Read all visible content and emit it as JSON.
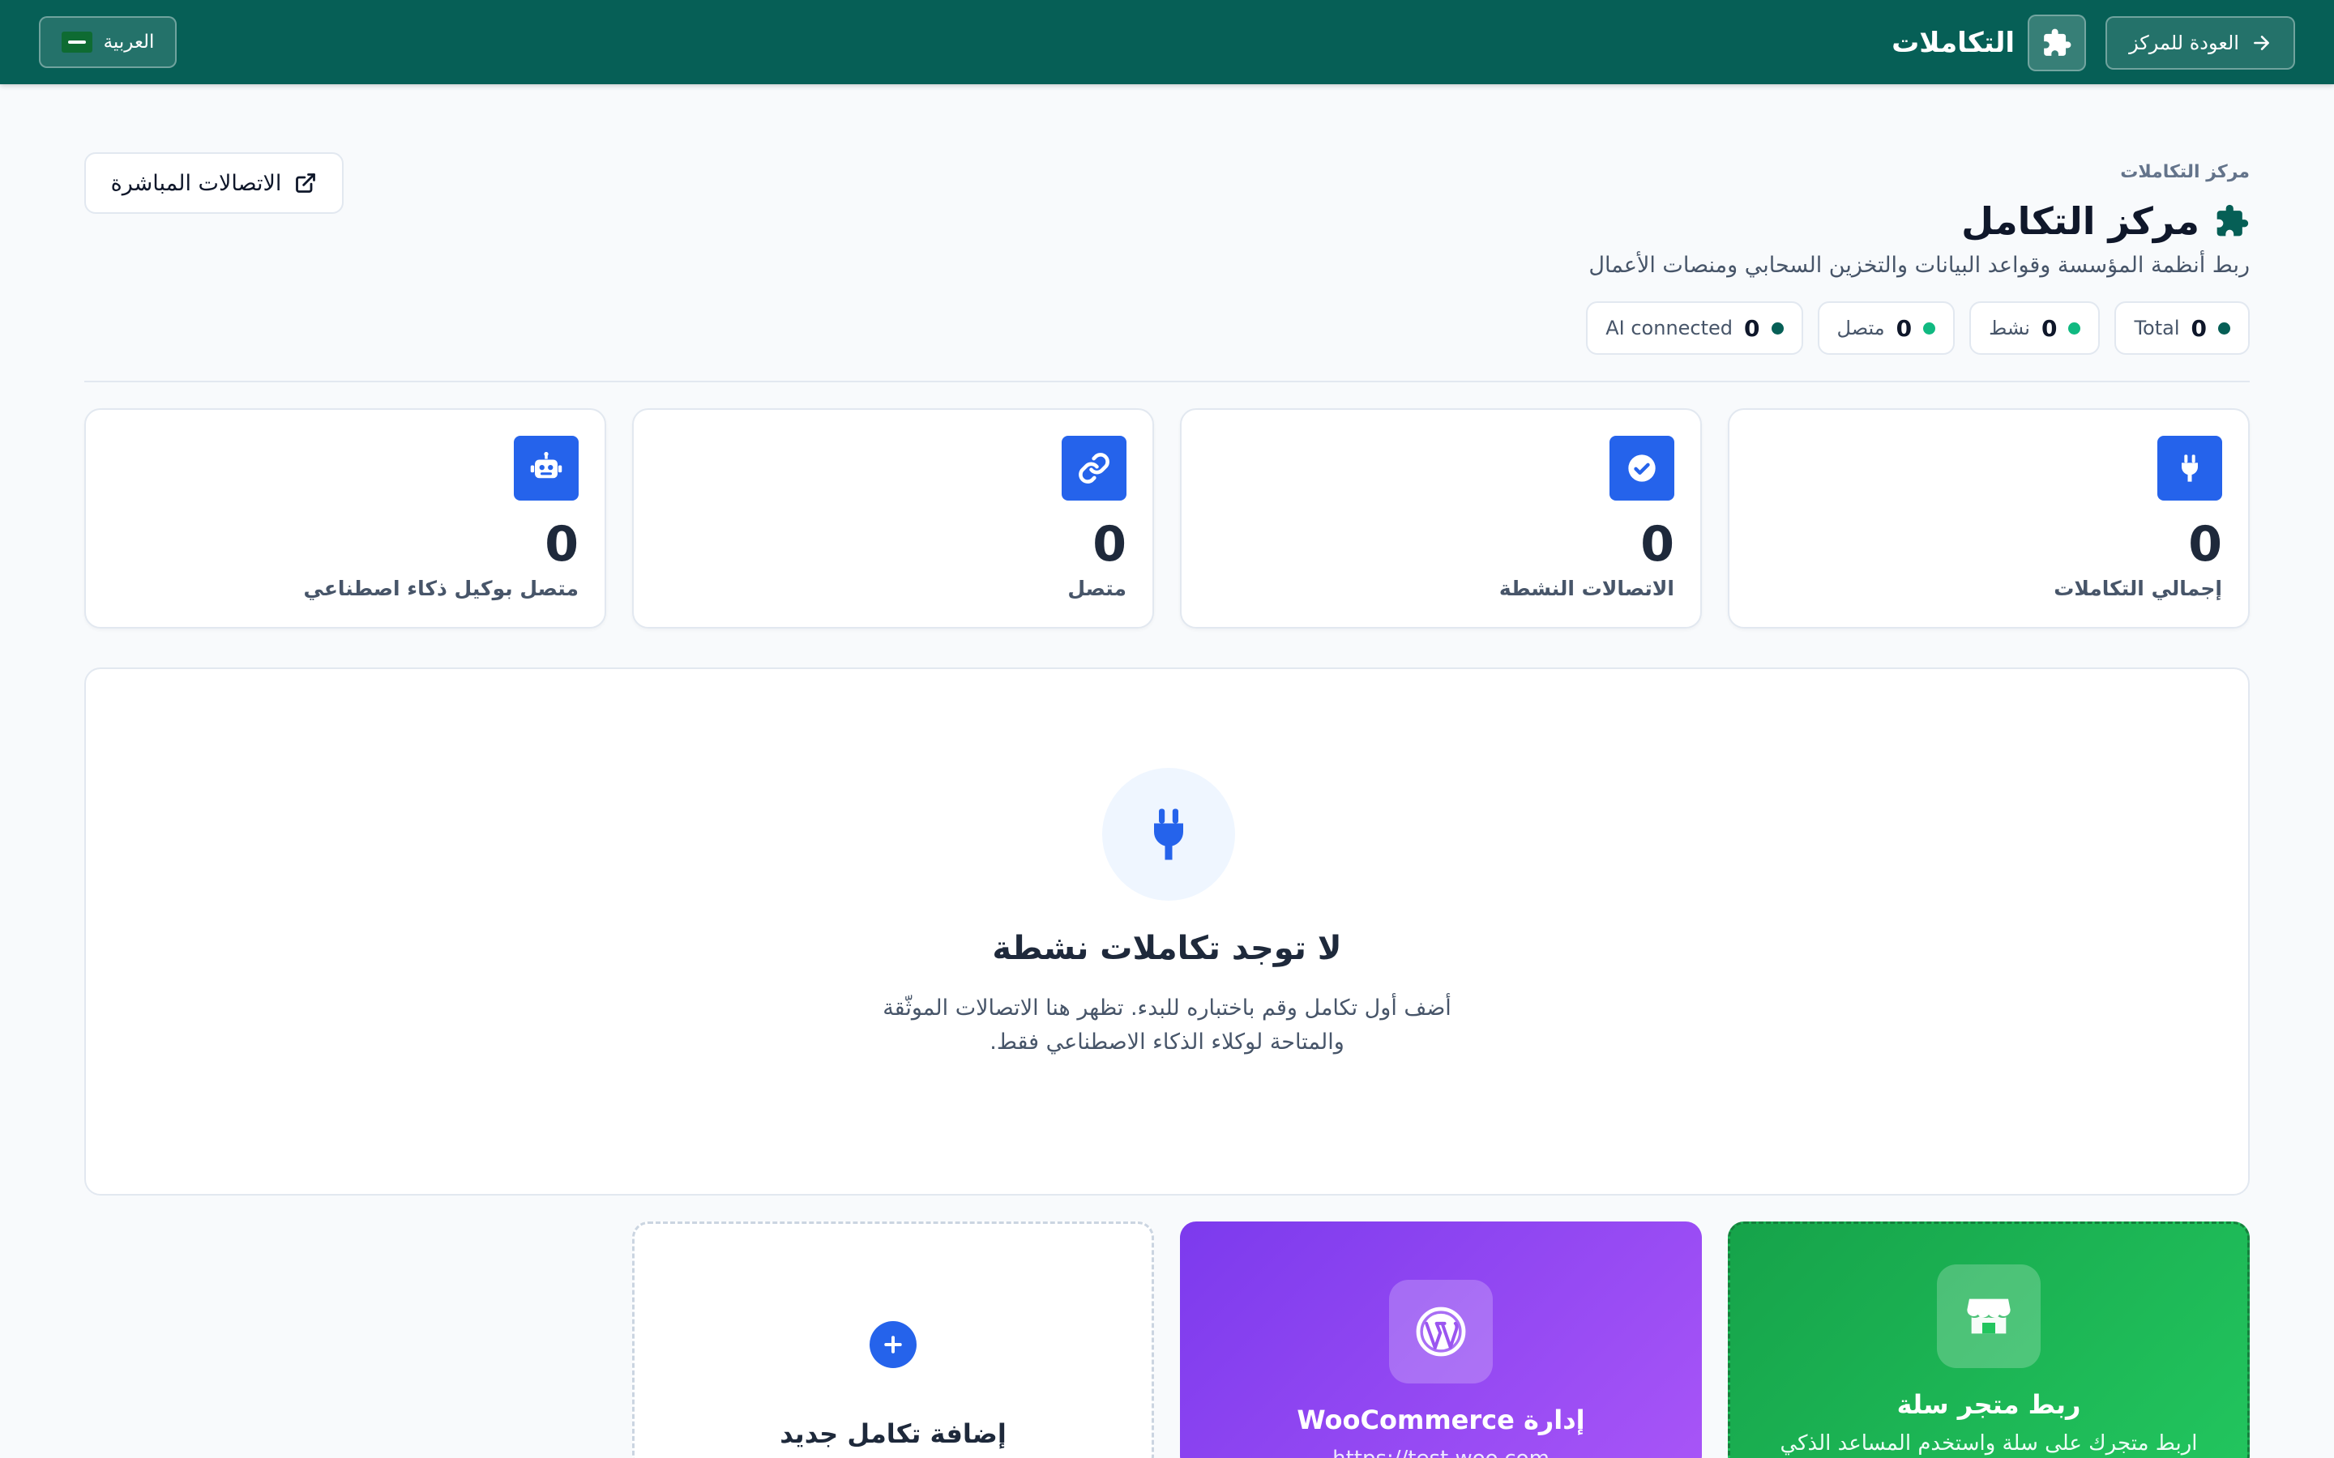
{
  "topbar": {
    "back_label": "العودة للمركز",
    "app_title": "التكاملات",
    "language_label": "العربية"
  },
  "header": {
    "breadcrumb": "مركز التكاملات",
    "title": "مركز التكامل",
    "subtitle": "ربط أنظمة المؤسسة وقواعد البيانات والتخزين السحابي ومنصات الأعمال",
    "live_connections_label": "الاتصالات المباشرة",
    "chips": [
      {
        "label": "Total",
        "value": "0",
        "color": "#065f56"
      },
      {
        "label": "نشط",
        "value": "0",
        "color": "#10b981"
      },
      {
        "label": "متصل",
        "value": "0",
        "color": "#10b981"
      },
      {
        "label": "AI connected",
        "value": "0",
        "color": "#065f56"
      }
    ]
  },
  "stats": [
    {
      "label": "إجمالي التكاملات",
      "value": "0",
      "icon": "plug-icon"
    },
    {
      "label": "الاتصالات النشطة",
      "value": "0",
      "icon": "check-circle-icon"
    },
    {
      "label": "متصل",
      "value": "0",
      "icon": "link-icon"
    },
    {
      "label": "متصل بوكيل ذكاء اصطناعي",
      "value": "0",
      "icon": "robot-icon"
    }
  ],
  "empty_state": {
    "title": "لا توجد تكاملات نشطة",
    "text": "أضف أول تكامل وقم باختباره للبدء. تظهر هنا الاتصالات الموثّقة والمتاحة لوكلاء الذكاء الاصطناعي فقط."
  },
  "cards": {
    "salla": {
      "title": "ربط متجر سلة",
      "text": "اربط متجرك على سلة واستخدم المساعد الذكي",
      "icon": "store-icon"
    },
    "woocommerce": {
      "title": "إدارة WooCommerce",
      "text": "https://test.woo.com",
      "icon": "wordpress-icon"
    },
    "add": {
      "title": "إضافة تكامل جديد",
      "icon": "plus-icon"
    }
  },
  "colors": {
    "topbar": "#065f56",
    "accent": "#2563eb",
    "salla": "#22c55e",
    "woocommerce": "#a855f7"
  }
}
